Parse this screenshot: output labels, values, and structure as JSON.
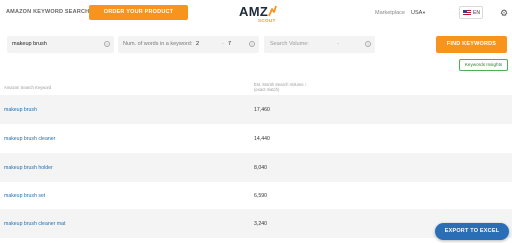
{
  "header": {
    "app_title": "AMAZON KEYWORD SEARCH",
    "order_button": "ORDER YOUR PRODUCT RESEARCH",
    "logo_main": "AMZ",
    "logo_sub": "SCOUT",
    "marketplace_label": "Marketplace",
    "marketplace_value": "USA",
    "language": "EN",
    "brand_color": "#f7941d"
  },
  "search": {
    "keyword_value": "makeup brush",
    "words_label": "Num. of words in a keyword:",
    "words_from": "2",
    "words_dash": "-",
    "words_to": "7",
    "volume_placeholder": "Search Volume:",
    "volume_dash": "-",
    "find_button": "FIND KEYWORDS",
    "insights_button": "Keywords Insights"
  },
  "table": {
    "col_keyword": "Amazon Search Keyword",
    "col_volume": "Est. Month Search Volume",
    "col_volume_sub": "(exact match)",
    "rows": [
      {
        "keyword": "makeup brush",
        "volume": "17,460"
      },
      {
        "keyword": "makeup brush cleaner",
        "volume": "14,440"
      },
      {
        "keyword": "makeup brush holder",
        "volume": "8,040"
      },
      {
        "keyword": "makeup brush set",
        "volume": "6,590"
      },
      {
        "keyword": "makeup brush cleaner mat",
        "volume": "3,240"
      }
    ]
  },
  "footer": {
    "export_button": "EXPORT TO EXCEL"
  }
}
